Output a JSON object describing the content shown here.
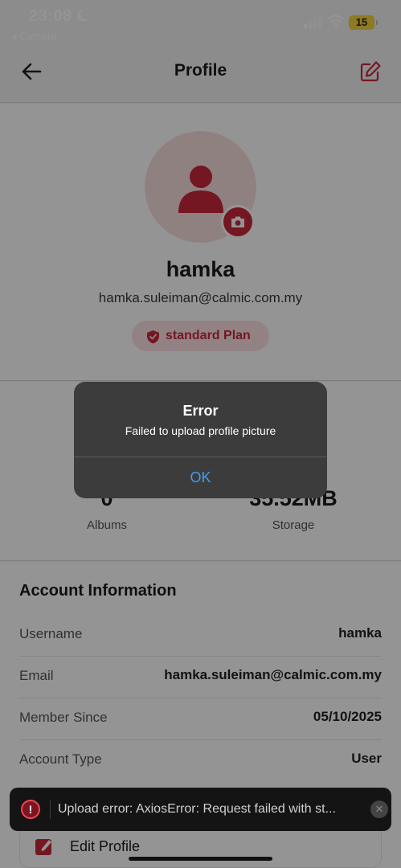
{
  "status_bar": {
    "time": "23:08",
    "back_app": "◂ Camera",
    "battery": "15",
    "icons": [
      "moon-icon",
      "signal-icon",
      "wifi-icon",
      "battery-icon"
    ]
  },
  "header": {
    "title": "Profile",
    "back_icon": "arrow-left-icon",
    "edit_icon": "edit-square-icon"
  },
  "profile": {
    "username": "hamka",
    "email": "hamka.suleiman@calmic.com.my",
    "plan": "standard Plan",
    "avatar_icon": "person-icon",
    "camera_icon": "camera-icon",
    "plan_icon": "shield-check-icon"
  },
  "stats": {
    "albums_value": "0",
    "albums_label": "Albums",
    "storage_value": "35.52MB",
    "storage_label": "Storage"
  },
  "account": {
    "section_title": "Account Information",
    "rows": [
      {
        "label": "Username",
        "value": "hamka"
      },
      {
        "label": "Email",
        "value": "hamka.suleiman@calmic.com.my"
      },
      {
        "label": "Member Since",
        "value": "05/10/2025"
      },
      {
        "label": "Account Type",
        "value": "User"
      }
    ],
    "edit_profile_label": "Edit Profile"
  },
  "alert": {
    "title": "Error",
    "message": "Failed to upload profile picture",
    "ok_label": "OK"
  },
  "toast": {
    "message": "Upload error: AxiosError: Request failed with st...",
    "icon": "alert-circle-icon",
    "close_icon": "close-icon"
  },
  "colors": {
    "accent": "#c8283c",
    "accent_light": "#fbe1e4",
    "alert_button": "#4a98f5"
  }
}
